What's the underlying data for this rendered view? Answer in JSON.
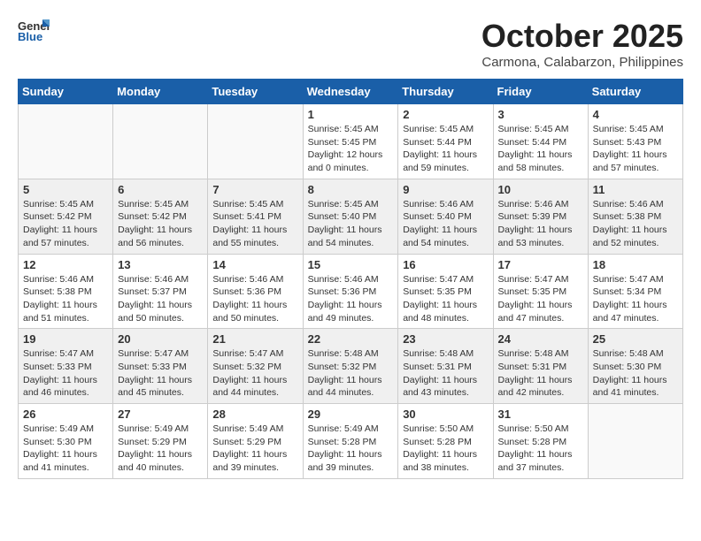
{
  "header": {
    "logo_general": "General",
    "logo_blue": "Blue",
    "month_title": "October 2025",
    "location": "Carmona, Calabarzon, Philippines"
  },
  "days_of_week": [
    "Sunday",
    "Monday",
    "Tuesday",
    "Wednesday",
    "Thursday",
    "Friday",
    "Saturday"
  ],
  "weeks": [
    [
      {
        "day": "",
        "info": ""
      },
      {
        "day": "",
        "info": ""
      },
      {
        "day": "",
        "info": ""
      },
      {
        "day": "1",
        "info": "Sunrise: 5:45 AM\nSunset: 5:45 PM\nDaylight: 12 hours\nand 0 minutes."
      },
      {
        "day": "2",
        "info": "Sunrise: 5:45 AM\nSunset: 5:44 PM\nDaylight: 11 hours\nand 59 minutes."
      },
      {
        "day": "3",
        "info": "Sunrise: 5:45 AM\nSunset: 5:44 PM\nDaylight: 11 hours\nand 58 minutes."
      },
      {
        "day": "4",
        "info": "Sunrise: 5:45 AM\nSunset: 5:43 PM\nDaylight: 11 hours\nand 57 minutes."
      }
    ],
    [
      {
        "day": "5",
        "info": "Sunrise: 5:45 AM\nSunset: 5:42 PM\nDaylight: 11 hours\nand 57 minutes."
      },
      {
        "day": "6",
        "info": "Sunrise: 5:45 AM\nSunset: 5:42 PM\nDaylight: 11 hours\nand 56 minutes."
      },
      {
        "day": "7",
        "info": "Sunrise: 5:45 AM\nSunset: 5:41 PM\nDaylight: 11 hours\nand 55 minutes."
      },
      {
        "day": "8",
        "info": "Sunrise: 5:45 AM\nSunset: 5:40 PM\nDaylight: 11 hours\nand 54 minutes."
      },
      {
        "day": "9",
        "info": "Sunrise: 5:46 AM\nSunset: 5:40 PM\nDaylight: 11 hours\nand 54 minutes."
      },
      {
        "day": "10",
        "info": "Sunrise: 5:46 AM\nSunset: 5:39 PM\nDaylight: 11 hours\nand 53 minutes."
      },
      {
        "day": "11",
        "info": "Sunrise: 5:46 AM\nSunset: 5:38 PM\nDaylight: 11 hours\nand 52 minutes."
      }
    ],
    [
      {
        "day": "12",
        "info": "Sunrise: 5:46 AM\nSunset: 5:38 PM\nDaylight: 11 hours\nand 51 minutes."
      },
      {
        "day": "13",
        "info": "Sunrise: 5:46 AM\nSunset: 5:37 PM\nDaylight: 11 hours\nand 50 minutes."
      },
      {
        "day": "14",
        "info": "Sunrise: 5:46 AM\nSunset: 5:36 PM\nDaylight: 11 hours\nand 50 minutes."
      },
      {
        "day": "15",
        "info": "Sunrise: 5:46 AM\nSunset: 5:36 PM\nDaylight: 11 hours\nand 49 minutes."
      },
      {
        "day": "16",
        "info": "Sunrise: 5:47 AM\nSunset: 5:35 PM\nDaylight: 11 hours\nand 48 minutes."
      },
      {
        "day": "17",
        "info": "Sunrise: 5:47 AM\nSunset: 5:35 PM\nDaylight: 11 hours\nand 47 minutes."
      },
      {
        "day": "18",
        "info": "Sunrise: 5:47 AM\nSunset: 5:34 PM\nDaylight: 11 hours\nand 47 minutes."
      }
    ],
    [
      {
        "day": "19",
        "info": "Sunrise: 5:47 AM\nSunset: 5:33 PM\nDaylight: 11 hours\nand 46 minutes."
      },
      {
        "day": "20",
        "info": "Sunrise: 5:47 AM\nSunset: 5:33 PM\nDaylight: 11 hours\nand 45 minutes."
      },
      {
        "day": "21",
        "info": "Sunrise: 5:47 AM\nSunset: 5:32 PM\nDaylight: 11 hours\nand 44 minutes."
      },
      {
        "day": "22",
        "info": "Sunrise: 5:48 AM\nSunset: 5:32 PM\nDaylight: 11 hours\nand 44 minutes."
      },
      {
        "day": "23",
        "info": "Sunrise: 5:48 AM\nSunset: 5:31 PM\nDaylight: 11 hours\nand 43 minutes."
      },
      {
        "day": "24",
        "info": "Sunrise: 5:48 AM\nSunset: 5:31 PM\nDaylight: 11 hours\nand 42 minutes."
      },
      {
        "day": "25",
        "info": "Sunrise: 5:48 AM\nSunset: 5:30 PM\nDaylight: 11 hours\nand 41 minutes."
      }
    ],
    [
      {
        "day": "26",
        "info": "Sunrise: 5:49 AM\nSunset: 5:30 PM\nDaylight: 11 hours\nand 41 minutes."
      },
      {
        "day": "27",
        "info": "Sunrise: 5:49 AM\nSunset: 5:29 PM\nDaylight: 11 hours\nand 40 minutes."
      },
      {
        "day": "28",
        "info": "Sunrise: 5:49 AM\nSunset: 5:29 PM\nDaylight: 11 hours\nand 39 minutes."
      },
      {
        "day": "29",
        "info": "Sunrise: 5:49 AM\nSunset: 5:28 PM\nDaylight: 11 hours\nand 39 minutes."
      },
      {
        "day": "30",
        "info": "Sunrise: 5:50 AM\nSunset: 5:28 PM\nDaylight: 11 hours\nand 38 minutes."
      },
      {
        "day": "31",
        "info": "Sunrise: 5:50 AM\nSunset: 5:28 PM\nDaylight: 11 hours\nand 37 minutes."
      },
      {
        "day": "",
        "info": ""
      }
    ]
  ]
}
